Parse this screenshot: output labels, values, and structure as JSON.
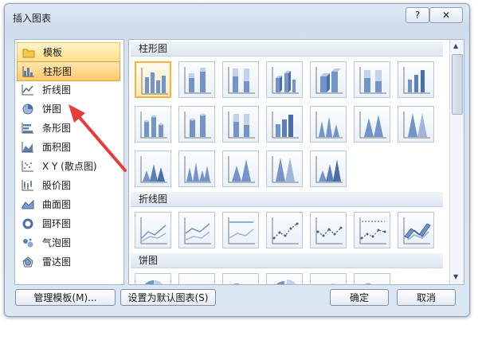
{
  "window": {
    "title": "插入图表",
    "help_label": "?",
    "close_label": "✕"
  },
  "sidebar": {
    "items": [
      {
        "label": "模板",
        "icon": "folder-icon"
      },
      {
        "label": "柱形图",
        "icon": "column-chart-icon"
      },
      {
        "label": "折线图",
        "icon": "line-chart-icon"
      },
      {
        "label": "饼图",
        "icon": "pie-chart-icon"
      },
      {
        "label": "条形图",
        "icon": "bar-chart-icon"
      },
      {
        "label": "面积图",
        "icon": "area-chart-icon"
      },
      {
        "label": "X Y (散点图)",
        "icon": "scatter-chart-icon"
      },
      {
        "label": "股价图",
        "icon": "stock-chart-icon"
      },
      {
        "label": "曲面图",
        "icon": "surface-chart-icon"
      },
      {
        "label": "圆环图",
        "icon": "doughnut-chart-icon"
      },
      {
        "label": "气泡图",
        "icon": "bubble-chart-icon"
      },
      {
        "label": "雷达图",
        "icon": "radar-chart-icon"
      }
    ],
    "selected_index": 1
  },
  "sections": [
    {
      "label": "柱形图"
    },
    {
      "label": "折线图"
    },
    {
      "label": "饼图"
    }
  ],
  "footer": {
    "manage_templates": "管理模板(M)...",
    "set_default": "设置为默认图表(S)",
    "ok": "确定",
    "cancel": "取消"
  },
  "colors": {
    "selection": "#ffc86a",
    "accent": "#e83b3b",
    "chart_blue": "#6f8fc4"
  }
}
